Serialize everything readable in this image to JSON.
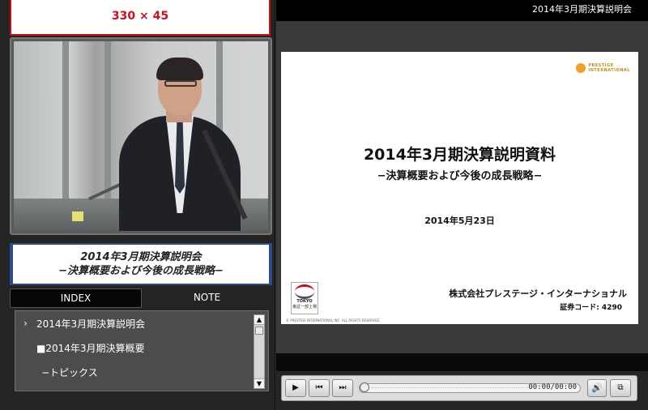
{
  "banner": {
    "text": "330 × 45"
  },
  "header": {
    "title": "2014年3月期決算説明会"
  },
  "session": {
    "title_line1": "2014年3月期決算説明会",
    "title_line2": "−決算概要および今後の成長戦略−"
  },
  "tabs": [
    {
      "label": "INDEX",
      "active": true
    },
    {
      "label": "NOTE",
      "active": false
    }
  ],
  "index_items": [
    {
      "bullet": "›",
      "label": "2014年3月期決算説明会"
    },
    {
      "bullet": "",
      "label": "■2014年3月期決算概要"
    },
    {
      "bullet": "",
      "label": "−トピックス"
    }
  ],
  "slide": {
    "logo_text_line1": "PRESTIGE",
    "logo_text_line2": "INTERNATIONAL",
    "title": "2014年3月期決算説明資料",
    "subtitle": "−決算概要および今後の成長戦略−",
    "date": "2014年5月23日",
    "badge_line1": "TOKYO",
    "badge_line2": "東証一部上場",
    "company": "株式会社プレステージ・インターナショナル",
    "code": "証券コード: 4290",
    "copyright": "© PRESTIGE INTERNATIONAL INC. ALL RIGHTS RESERVED."
  },
  "player": {
    "play_icon": "▶",
    "prev_icon": "⏮",
    "next_icon": "⏭",
    "time": "00:00/00:00",
    "volume_icon": "🔊",
    "popout_icon": "⧉"
  }
}
